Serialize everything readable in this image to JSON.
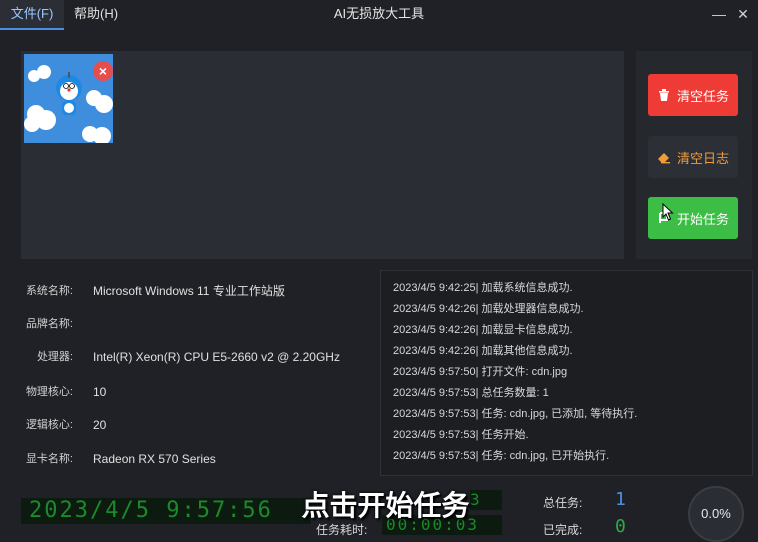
{
  "menu": {
    "file": "文件(F)",
    "help": "帮助(H)"
  },
  "window": {
    "title": "AI无损放大工具",
    "minimize": "—",
    "close": "✕"
  },
  "buttons": {
    "clear_tasks": "清空任务",
    "clear_log": "清空日志",
    "start_tasks": "开始任务"
  },
  "system_info": [
    {
      "label": "系统名称:",
      "value": "Microsoft Windows 11 专业工作站版"
    },
    {
      "label": "品牌名称:",
      "value": ""
    },
    {
      "label": "处理器:",
      "value": "Intel(R) Xeon(R) CPU E5-2660 v2 @ 2.20GHz"
    },
    {
      "label": "物理核心:",
      "value": "10"
    },
    {
      "label": "逻辑核心:",
      "value": "20"
    },
    {
      "label": "显卡名称:",
      "value": "Radeon RX 570 Series"
    }
  ],
  "log": [
    "2023/4/5 9:42:25| 加载系统信息成功.",
    "2023/4/5 9:42:26| 加载处理器信息成功.",
    "2023/4/5 9:42:26| 加载显卡信息成功.",
    "2023/4/5 9:42:26| 加载其他信息成功.",
    "2023/4/5 9:57:50| 打开文件: cdn.jpg",
    "2023/4/5 9:57:53| 总任务数量: 1",
    "2023/4/5 9:57:53| 任务: cdn.jpg, 已添加, 等待执行.",
    "2023/4/5 9:57:53| 任务开始.",
    "2023/4/5 9:57:53| 任务: cdn.jpg, 已开始执行."
  ],
  "status": {
    "clock": "2023/4/5 9:57:56",
    "elapsed_label": "任务耗时:",
    "elapsed": "00:00:03",
    "elapsed_tail": "3",
    "total_label": "总任务:",
    "total": "1",
    "done_label": "已完成:",
    "done": "0",
    "progress": "0.0%"
  },
  "subtitle": "点击开始任务",
  "colors": {
    "clear_tasks": "#ef3b36",
    "start_tasks": "#3cbd45",
    "clear_log_text": "#f29b3a",
    "accent": "#4a90e2"
  }
}
